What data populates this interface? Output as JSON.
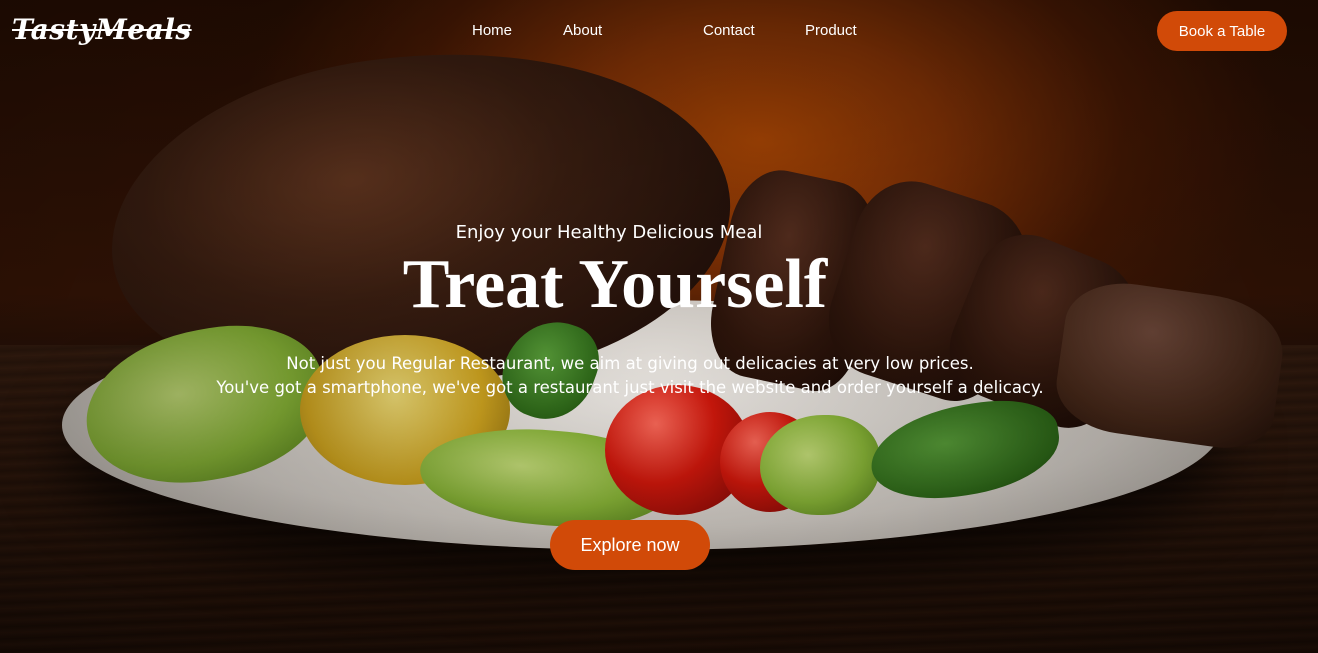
{
  "brand": {
    "logo_text": "TastyMeals"
  },
  "nav": {
    "links": [
      "Home",
      "About",
      "Contact",
      "Product"
    ],
    "cta_label": "Book a Table"
  },
  "hero": {
    "tagline": "Enjoy your Healthy Delicious Meal",
    "headline": "Treat Yourself",
    "description_line1": "Not just you Regular Restaurant, we aim at giving out delicacies at very low prices.",
    "description_line2": "You've got a smartphone, we've got a restaurant just visit the website and order yourself a delicacy.",
    "cta_label": "Explore now"
  },
  "colors": {
    "accent": "#d14a08",
    "text": "#ffffff"
  }
}
